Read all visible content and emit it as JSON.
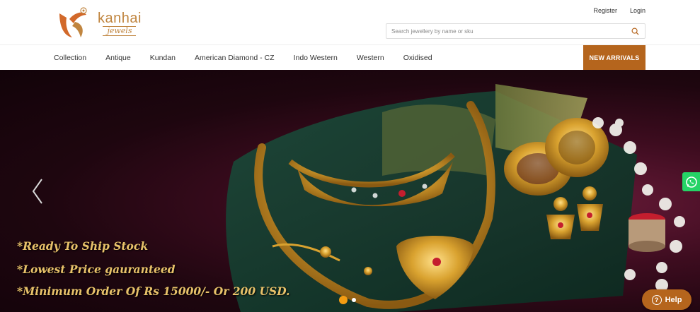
{
  "brand": {
    "name": "kanhai",
    "sub": "jewels",
    "color": "#c0853f"
  },
  "header": {
    "register_label": "Register",
    "login_label": "Login"
  },
  "search": {
    "placeholder": "Search jewellery by name or sku",
    "value": ""
  },
  "nav": {
    "items": [
      {
        "label": "Collection"
      },
      {
        "label": "Antique"
      },
      {
        "label": "Kundan"
      },
      {
        "label": "American Diamond - CZ"
      },
      {
        "label": "Indo Western"
      },
      {
        "label": "Western"
      },
      {
        "label": "Oxidised"
      }
    ],
    "new_arrivals_label": "NEW ARRIVALS",
    "accent": "#b5651d"
  },
  "hero": {
    "promo_lines": [
      "*Ready To Ship Stock",
      "*Lowest Price gauranteed",
      "*Minimum Order Of Rs 15000/- Or 200 USD."
    ],
    "promo_color": "#e8c26a",
    "slide_count": 2,
    "active_slide": 1
  },
  "widgets": {
    "whatsapp_icon": "whatsapp-icon",
    "help_label": "Help"
  }
}
